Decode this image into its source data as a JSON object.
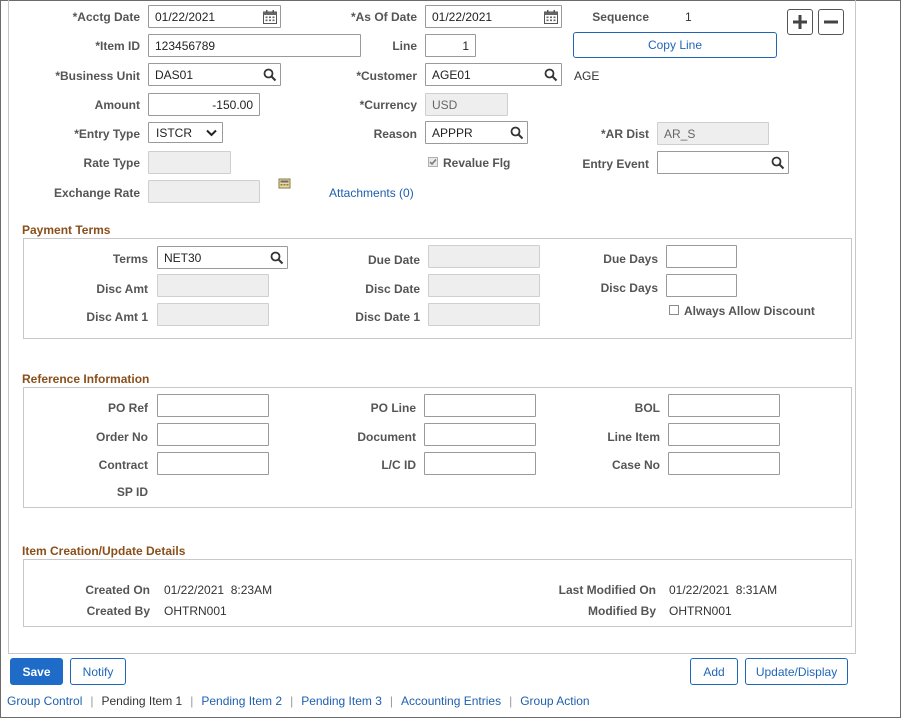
{
  "header": {
    "acctg_date": {
      "label": "*Acctg Date",
      "value": "01/22/2021"
    },
    "as_of_date": {
      "label": "*As Of Date",
      "value": "01/22/2021"
    },
    "sequence": {
      "label": "Sequence",
      "value": "1"
    },
    "item_id": {
      "label": "*Item ID",
      "value": "123456789"
    },
    "line": {
      "label": "Line",
      "value": "1"
    },
    "copy_line_label": "Copy Line",
    "business_unit": {
      "label": "*Business Unit",
      "value": "DAS01"
    },
    "customer": {
      "label": "*Customer",
      "value": "AGE01",
      "name": "AGE"
    },
    "amount": {
      "label": "Amount",
      "value": "-150.00"
    },
    "currency": {
      "label": "*Currency",
      "value": "USD"
    },
    "entry_type": {
      "label": "*Entry Type",
      "value": "ISTCR"
    },
    "reason": {
      "label": "Reason",
      "value": "APPPR"
    },
    "ar_dist": {
      "label": "*AR Dist",
      "value": "AR_S"
    },
    "rate_type": {
      "label": "Rate Type",
      "value": ""
    },
    "revalue_flg": {
      "label": "Revalue Flg",
      "checked": true
    },
    "entry_event": {
      "label": "Entry Event",
      "value": ""
    },
    "exchange_rate": {
      "label": "Exchange Rate",
      "value": ""
    },
    "attachments_label": "Attachments (0)"
  },
  "payment_terms": {
    "title": "Payment Terms",
    "terms": {
      "label": "Terms",
      "value": "NET30"
    },
    "due_date": {
      "label": "Due Date",
      "value": ""
    },
    "due_days": {
      "label": "Due Days",
      "value": ""
    },
    "disc_amt": {
      "label": "Disc Amt",
      "value": ""
    },
    "disc_date": {
      "label": "Disc Date",
      "value": ""
    },
    "disc_days": {
      "label": "Disc Days",
      "value": ""
    },
    "disc_amt_1": {
      "label": "Disc Amt 1",
      "value": ""
    },
    "disc_date_1": {
      "label": "Disc Date 1",
      "value": ""
    },
    "always_allow_discount": {
      "label": "Always Allow Discount",
      "checked": false
    }
  },
  "reference": {
    "title": "Reference Information",
    "po_ref": {
      "label": "PO Ref",
      "value": ""
    },
    "po_line": {
      "label": "PO Line",
      "value": ""
    },
    "bol": {
      "label": "BOL",
      "value": ""
    },
    "order_no": {
      "label": "Order No",
      "value": ""
    },
    "document": {
      "label": "Document",
      "value": ""
    },
    "line_item": {
      "label": "Line Item",
      "value": ""
    },
    "contract": {
      "label": "Contract",
      "value": ""
    },
    "lc_id": {
      "label": "L/C ID",
      "value": ""
    },
    "case_no": {
      "label": "Case No",
      "value": ""
    },
    "sp_id": {
      "label": "SP ID"
    }
  },
  "details": {
    "title": "Item Creation/Update Details",
    "created_on": {
      "label": "Created On",
      "value": "01/22/2021  8:23AM"
    },
    "created_by": {
      "label": "Created By",
      "value": "OHTRN001"
    },
    "last_modified_on": {
      "label": "Last Modified On",
      "value": "01/22/2021  8:31AM"
    },
    "modified_by": {
      "label": "Modified By",
      "value": "OHTRN001"
    }
  },
  "toolbar": {
    "save_label": "Save",
    "notify_label": "Notify",
    "add_label": "Add",
    "update_display_label": "Update/Display"
  },
  "page_tabs": {
    "group_control": "Group Control",
    "pending_item_1": "Pending Item 1",
    "pending_item_2": "Pending Item 2",
    "pending_item_3": "Pending Item 3",
    "accounting_entries": "Accounting Entries",
    "group_action": "Group Action",
    "separator": "|"
  },
  "colors": {
    "accent": "#1f6bc8",
    "section_title": "#8a4f1a",
    "link": "#1f5fae"
  }
}
